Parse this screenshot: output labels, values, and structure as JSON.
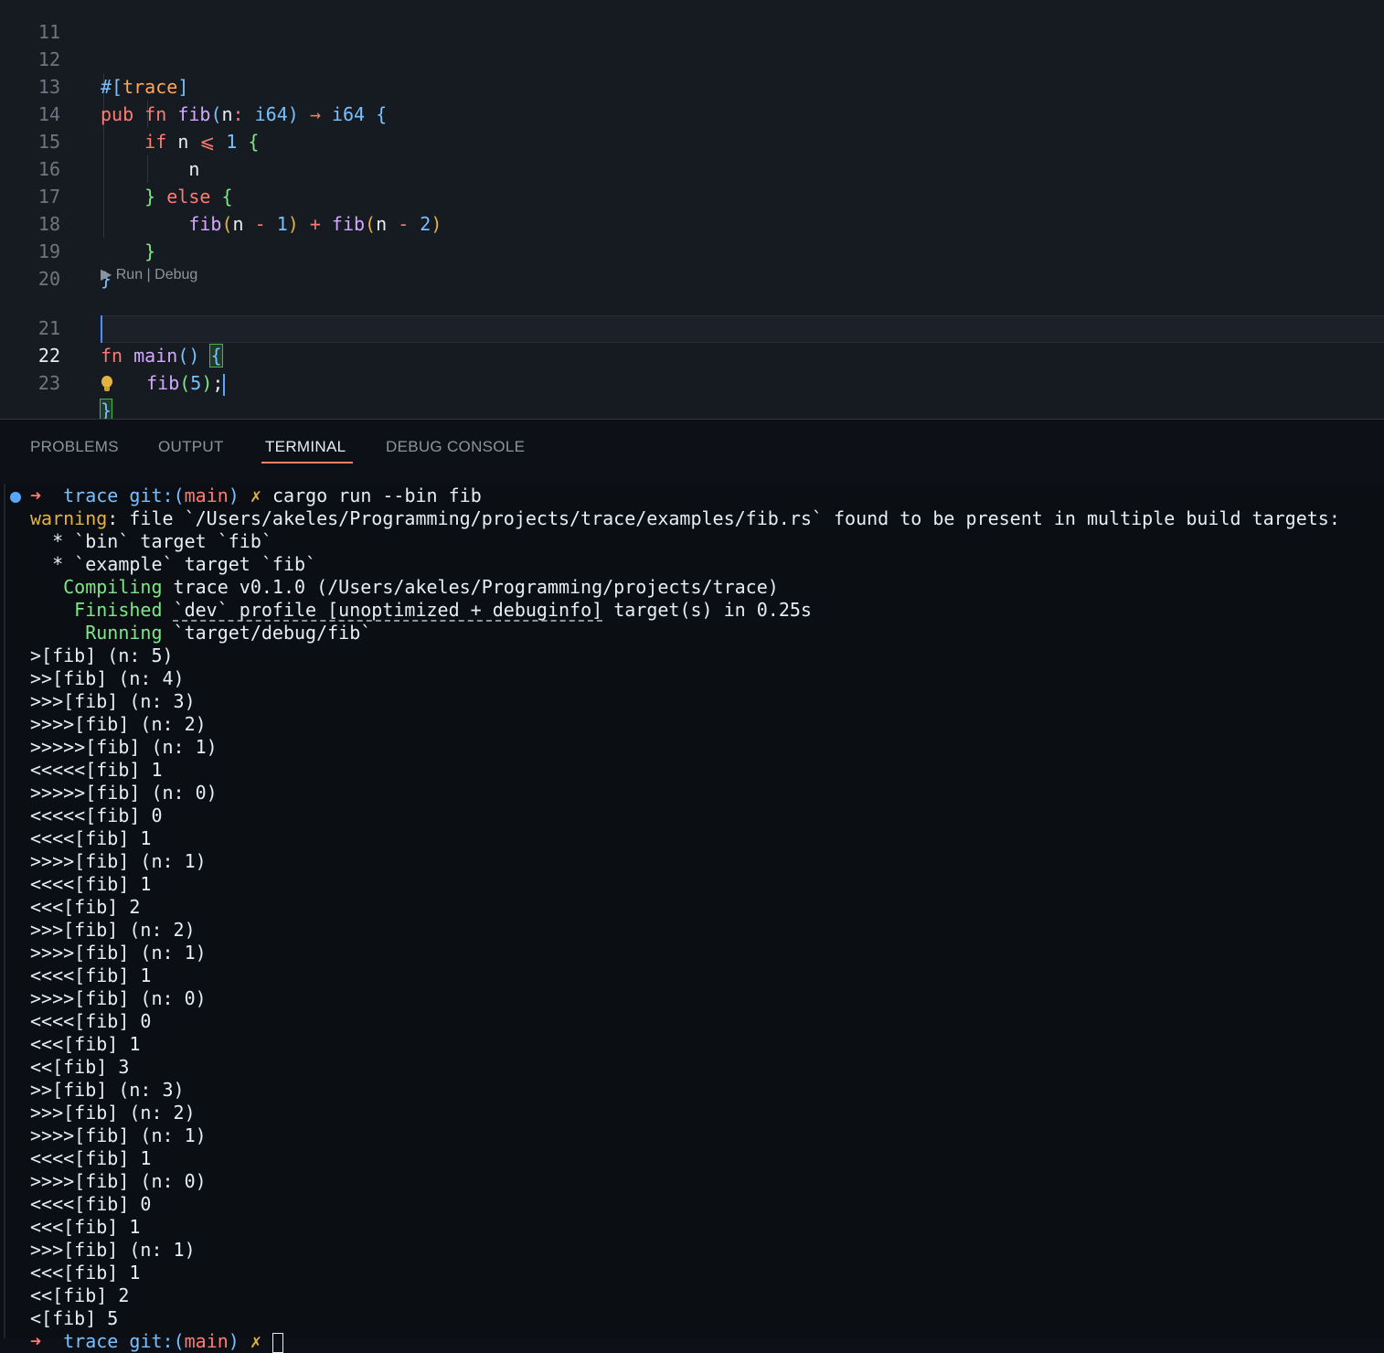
{
  "editor": {
    "line_numbers": [
      "11",
      "12",
      "13",
      "14",
      "15",
      "16",
      "17",
      "18",
      "19",
      "20",
      "21",
      "22",
      "23"
    ],
    "codelens": {
      "run": "▶ Run",
      "separator": " | ",
      "debug": "Debug"
    },
    "code": {
      "l11": "",
      "l12_attr_open": "#[",
      "l12_attr_name": "trace",
      "l12_attr_close": "]",
      "l13_pub": "pub",
      "l13_fn": "fn",
      "l13_name": "fib",
      "l13_p_open": "(",
      "l13_param": "n",
      "l13_colon": ":",
      "l13_type": "i64",
      "l13_p_close": ")",
      "l13_arrow": "→",
      "l13_ret": "i64",
      "l13_brace": "{",
      "l14_if": "if",
      "l14_n": "n",
      "l14_le": "⩽",
      "l14_one": "1",
      "l14_brace": "{",
      "l15_n": "n",
      "l16_close": "}",
      "l16_else": "else",
      "l16_open": "{",
      "l17_fib1": "fib",
      "l17_p1": "(",
      "l17_n1": "n",
      "l17_minus1": "-",
      "l17_one": "1",
      "l17_pc1": ")",
      "l17_plus": "+",
      "l17_fib2": "fib",
      "l17_p2": "(",
      "l17_n2": "n",
      "l17_minus2": "-",
      "l17_two": "2",
      "l17_pc2": ")",
      "l18_close": "}",
      "l19_close": "}",
      "l21_fn": "fn",
      "l21_name": "main",
      "l21_parens": "()",
      "l21_brace": "{",
      "l22_fib": "fib",
      "l22_p": "(",
      "l22_arg": "5",
      "l22_pc": ")",
      "l22_semi": ";",
      "l23_close": "}"
    }
  },
  "panel": {
    "tabs": [
      "PROBLEMS",
      "OUTPUT",
      "TERMINAL",
      "DEBUG CONSOLE"
    ],
    "active_tab": "TERMINAL"
  },
  "terminal": {
    "prompt": {
      "arrow": "➜",
      "dir": "trace",
      "git_label": "git:(",
      "branch": "main",
      "git_close": ")",
      "dirty": "✗",
      "command": "cargo run --bin fib"
    },
    "warning": {
      "label": "warning",
      "message": ": file `/Users/akeles/Programming/projects/trace/examples/fib.rs` found to be present in multiple build targets:",
      "items": [
        "  * `bin` target `fib`",
        "  * `example` target `fib`"
      ]
    },
    "cargo": {
      "compiling_label": "   Compiling",
      "compiling_text": " trace v0.1.0 (/Users/akeles/Programming/projects/trace)",
      "finished_label": "    Finished",
      "finished_underlined": "`dev` profile [unoptimized + debuginfo]",
      "finished_rest": " target(s) in 0.25s",
      "running_label": "     Running",
      "running_text": " `target/debug/fib`"
    },
    "output": [
      ">[fib] (n: 5)",
      ">>[fib] (n: 4)",
      ">>>[fib] (n: 3)",
      ">>>>[fib] (n: 2)",
      ">>>>>[fib] (n: 1)",
      "<<<<<[fib] 1",
      ">>>>>[fib] (n: 0)",
      "<<<<<[fib] 0",
      "<<<<[fib] 1",
      ">>>>[fib] (n: 1)",
      "<<<<[fib] 1",
      "<<<[fib] 2",
      ">>>[fib] (n: 2)",
      ">>>>[fib] (n: 1)",
      "<<<<[fib] 1",
      ">>>>[fib] (n: 0)",
      "<<<<[fib] 0",
      "<<<[fib] 1",
      "<<[fib] 3",
      ">>[fib] (n: 3)",
      ">>>[fib] (n: 2)",
      ">>>>[fib] (n: 1)",
      "<<<<[fib] 1",
      ">>>>[fib] (n: 0)",
      "<<<<[fib] 0",
      "<<<[fib] 1",
      ">>>[fib] (n: 1)",
      "<<<[fib] 1",
      "<<[fib] 2",
      "<[fib] 5"
    ],
    "final_prompt": {
      "dir": "trace",
      "git_label": "git:(",
      "branch": "main",
      "git_close": ")",
      "dirty": "✗"
    }
  }
}
